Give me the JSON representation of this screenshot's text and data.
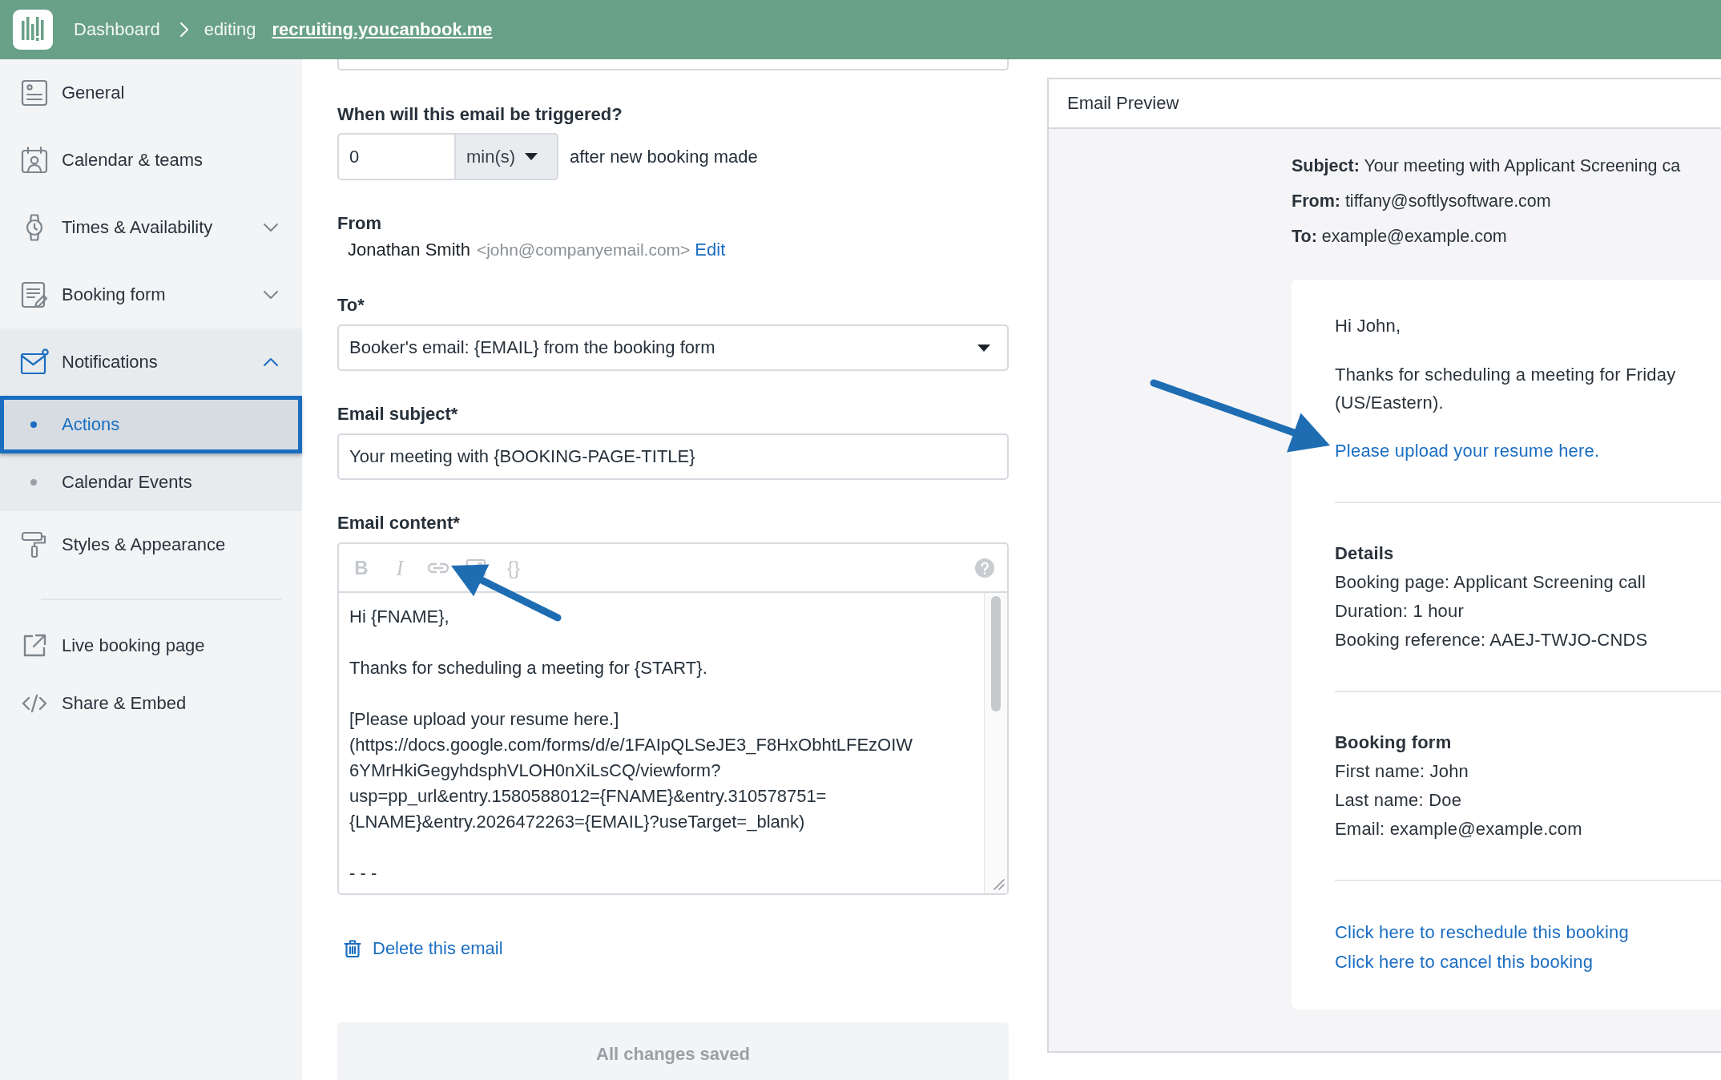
{
  "top_bar": {
    "breadcrumb": {
      "home": "Dashboard",
      "mode": "editing",
      "site_link": "recruiting.youcanbook.me"
    }
  },
  "sidebar": {
    "items": [
      {
        "label": "General",
        "kind": "page"
      },
      {
        "label": "Calendar & teams",
        "kind": "page"
      },
      {
        "label": "Times & Availability",
        "kind": "group",
        "expanded": false
      },
      {
        "label": "Booking form",
        "kind": "group",
        "expanded": false
      },
      {
        "label": "Notifications",
        "kind": "group",
        "expanded": true,
        "children": [
          {
            "label": "Actions",
            "selected": true
          },
          {
            "label": "Calendar Events",
            "selected": false
          }
        ]
      },
      {
        "label": "Styles & Appearance",
        "kind": "page"
      }
    ],
    "links": [
      {
        "label": "Live booking page"
      },
      {
        "label": "Share & Embed"
      }
    ]
  },
  "email_form": {
    "trigger": {
      "label": "When will this email be triggered?",
      "amount": "0",
      "unit": "min(s)",
      "suffix": "after new booking made"
    },
    "from": {
      "label": "From",
      "name": "Jonathan Smith",
      "address": "<john@companyemail.com>",
      "edit_link": "Edit"
    },
    "to": {
      "label": "To*",
      "value": "Booker's email: {EMAIL} from the booking form"
    },
    "subject": {
      "label": "Email subject*",
      "value": "Your meeting with {BOOKING-PAGE-TITLE}"
    },
    "content": {
      "label": "Email content*",
      "toolbar": {
        "bold": "B",
        "italic": "I",
        "variables": "{}"
      },
      "paragraphs": [
        [
          "Hi {FNAME},"
        ],
        [
          "Thanks for scheduling a meeting for {START}."
        ],
        [
          "[Please upload your resume here.]",
          "(https://docs.google.com/forms/d/e/1FAIpQLSeJE3_F8HxObhtLFEzOIW",
          "6YMrHkiGegyhdsphVLOH0nXiLsCQ/viewform?",
          "usp=pp_url&entry.1580588012={FNAME}&entry.310578751=",
          "{LNAME}&entry.2026472263={EMAIL}?useTarget=_blank)"
        ],
        [
          "- - -"
        ]
      ]
    },
    "delete_link": "Delete this email",
    "save_status": "All changes saved"
  },
  "email_preview": {
    "title": "Email Preview",
    "headers": [
      "**Subject:** Your meeting with Applicant Screening ca",
      "**From:** tiffany@softlysoftware.com",
      "**To:** example@example.com"
    ],
    "greeting": "Hi John,",
    "intro": [
      "Thanks for scheduling a meeting for Friday",
      "(US/Eastern)."
    ],
    "upload_link": "Please upload your resume here.",
    "sections": [
      {
        "heading": "Details",
        "lines": [
          "Booking page: Applicant Screening call",
          "Duration: 1 hour",
          "Booking reference: AAEJ-TWJO-CNDS"
        ]
      },
      {
        "heading": "Booking form",
        "lines": [
          "First name: John",
          "Last name: Doe",
          "Email: example@example.com"
        ]
      }
    ],
    "links": [
      "Click here to reschedule this booking",
      "Click here to cancel this booking"
    ]
  }
}
